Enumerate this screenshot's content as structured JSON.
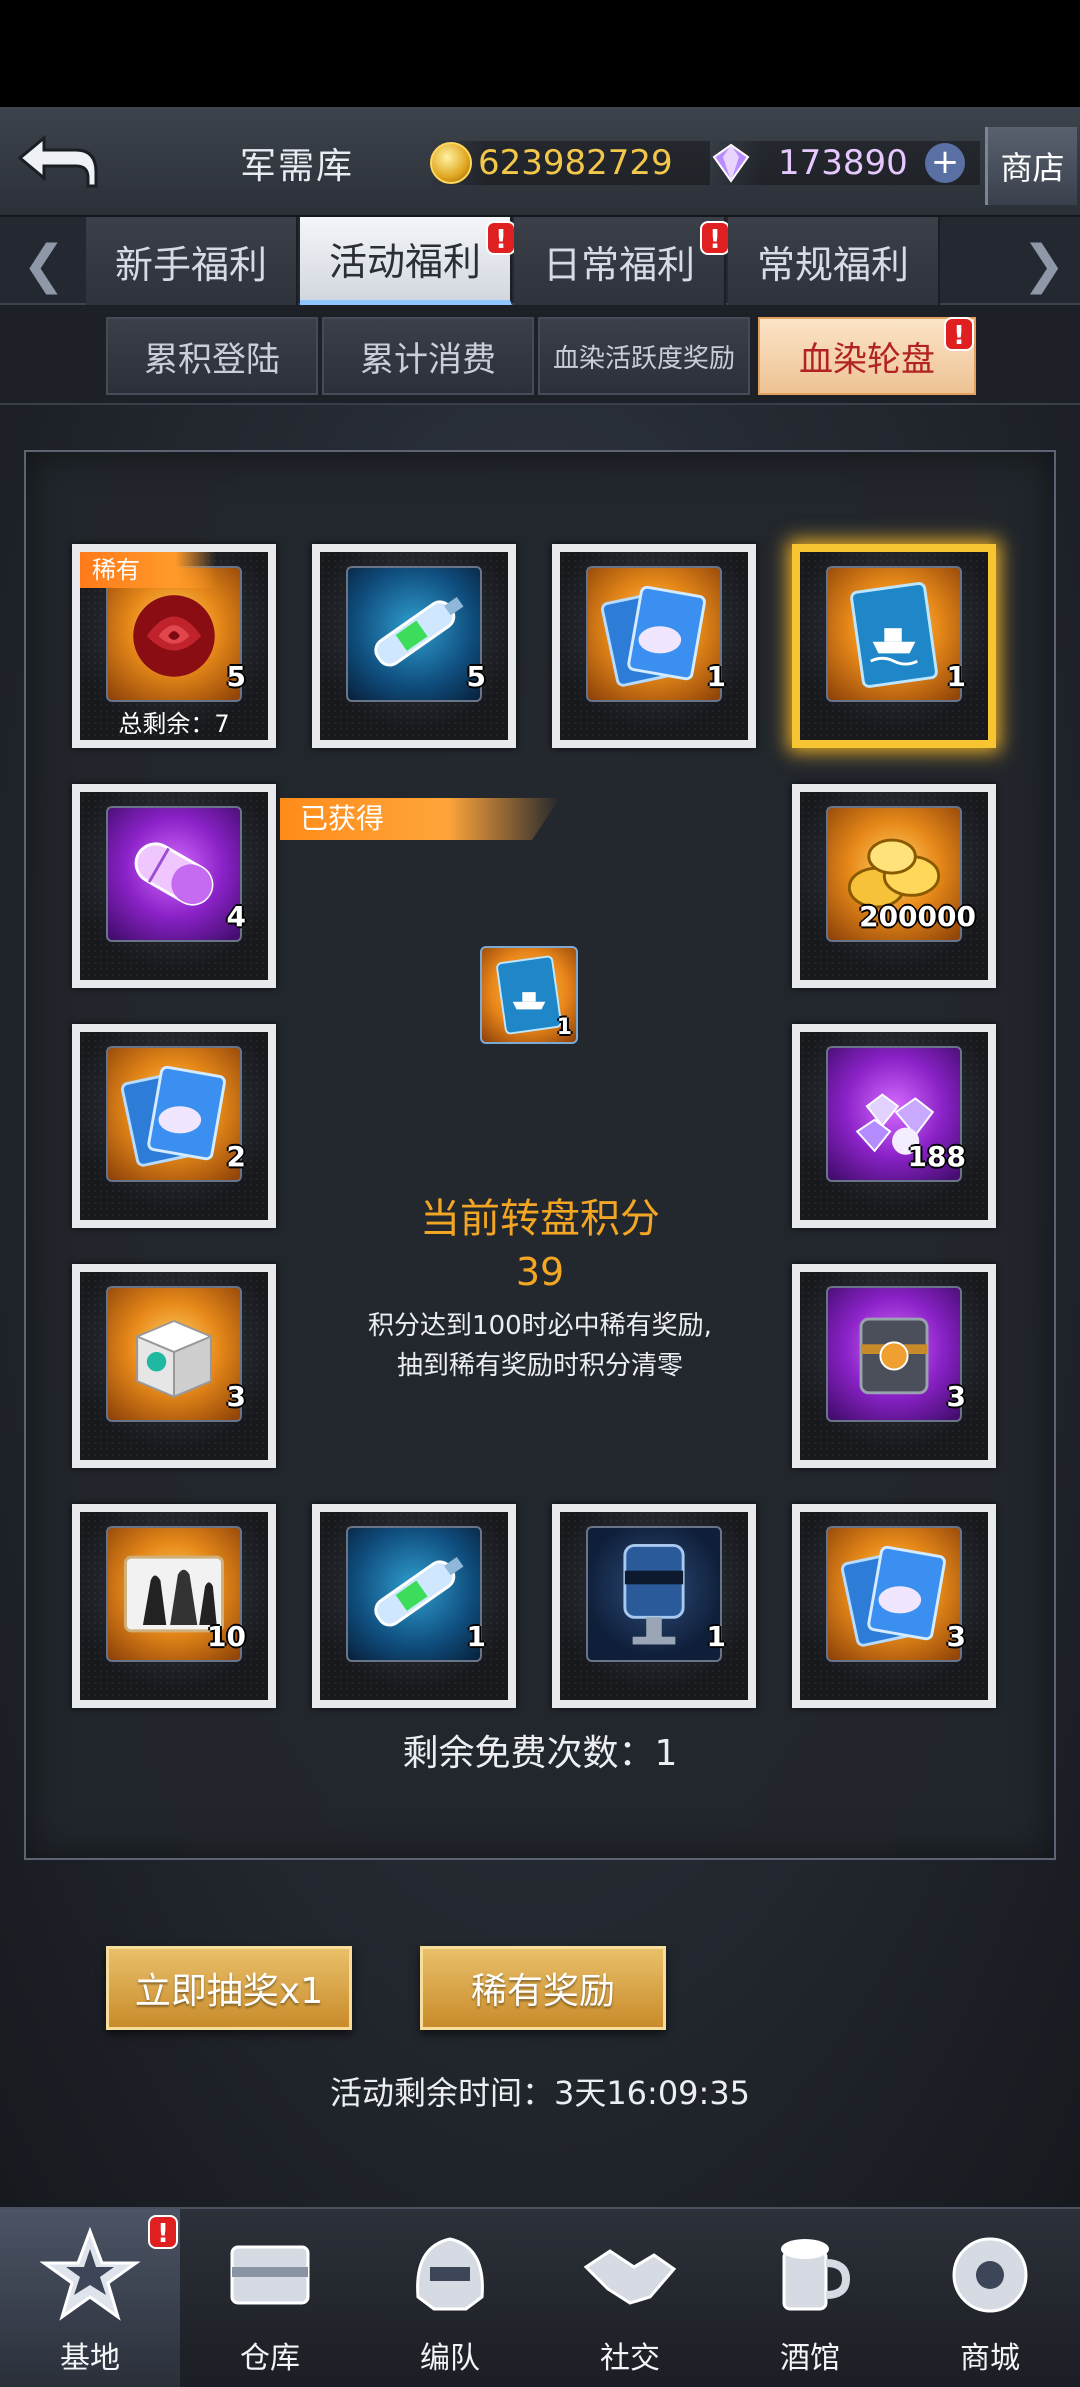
{
  "header": {
    "title": "军需库",
    "gold": "623982729",
    "gems": "173890",
    "plus": "+",
    "shop": "商店"
  },
  "tabs": [
    {
      "label": "新手福利"
    },
    {
      "label": "活动福利"
    },
    {
      "label": "日常福利"
    },
    {
      "label": "常规福利"
    }
  ],
  "tab_badges": [
    "!",
    "!"
  ],
  "subtabs": [
    {
      "label": "累积登陆"
    },
    {
      "label": "累计消费"
    },
    {
      "label": "血染活跃度奖励"
    },
    {
      "label": "血染轮盘"
    }
  ],
  "subtab_badge": "!",
  "wheel": {
    "rare_tag": "稀有",
    "total_remaining": "总剩余：7",
    "obtained_label": "已获得",
    "items": [
      {
        "qty": "5",
        "icon": "rose-icon"
      },
      {
        "qty": "5",
        "icon": "syringe-icon"
      },
      {
        "qty": "1",
        "icon": "diamond-card-icon"
      },
      {
        "qty": "1",
        "icon": "ship-card-icon"
      },
      {
        "qty": "200000",
        "icon": "gold-coins-icon"
      },
      {
        "qty": "188",
        "icon": "gems-pile-icon"
      },
      {
        "qty": "3",
        "icon": "mystery-box-icon"
      },
      {
        "qty": "3",
        "icon": "diamond-card-icon"
      },
      {
        "qty": "1",
        "icon": "coating-canister-icon"
      },
      {
        "qty": "1",
        "icon": "syringe-icon"
      },
      {
        "qty": "10",
        "icon": "character-card-icon"
      },
      {
        "qty": "3",
        "icon": "white-crate-icon"
      },
      {
        "qty": "2",
        "icon": "diamond-card-icon"
      },
      {
        "qty": "4",
        "icon": "capsule-icon"
      }
    ],
    "current_reward_qty": "1",
    "score_title": "当前转盘积分",
    "score_value": "39",
    "score_desc_1": "积分达到100时必中稀有奖励,",
    "score_desc_2": "抽到稀有奖励时积分清零",
    "free_count": "剩余免费次数：1"
  },
  "actions": {
    "draw": "立即抽奖x1",
    "rare": "稀有奖励"
  },
  "timer": "活动剩余时间：3天16:09:35",
  "nav": [
    {
      "label": "基地"
    },
    {
      "label": "仓库"
    },
    {
      "label": "编队"
    },
    {
      "label": "社交"
    },
    {
      "label": "酒馆"
    },
    {
      "label": "商城"
    }
  ],
  "nav_badge": "!",
  "colors": {
    "accent": "#f2a623",
    "badge": "#e02020",
    "selected": "#f7c531"
  }
}
